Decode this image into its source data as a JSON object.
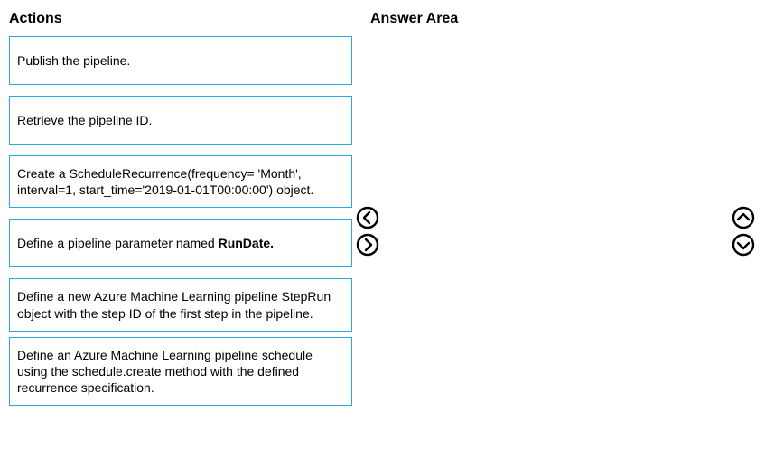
{
  "headings": {
    "actions": "Actions",
    "answer": "Answer Area"
  },
  "actions": [
    {
      "text": "Publish the pipeline."
    },
    {
      "text": "Retrieve the pipeline ID."
    },
    {
      "text": "Create a ScheduleRecurrence(frequency= 'Month', interval=1, start_time='2019-01-01T00:00:00') object."
    },
    {
      "prefix": "Define a pipeline parameter named ",
      "bold": "RunDate."
    },
    {
      "text": "Define a new Azure Machine Learning pipeline StepRun object with the step ID of the first step in the pipeline."
    },
    {
      "text": "Define an Azure Machine Learning pipeline schedule using the schedule.create method with the defined recurrence specification."
    }
  ],
  "icons": {
    "left": "chevron-left-circle-icon",
    "right": "chevron-right-circle-icon",
    "up": "chevron-up-circle-icon",
    "down": "chevron-down-circle-icon"
  }
}
